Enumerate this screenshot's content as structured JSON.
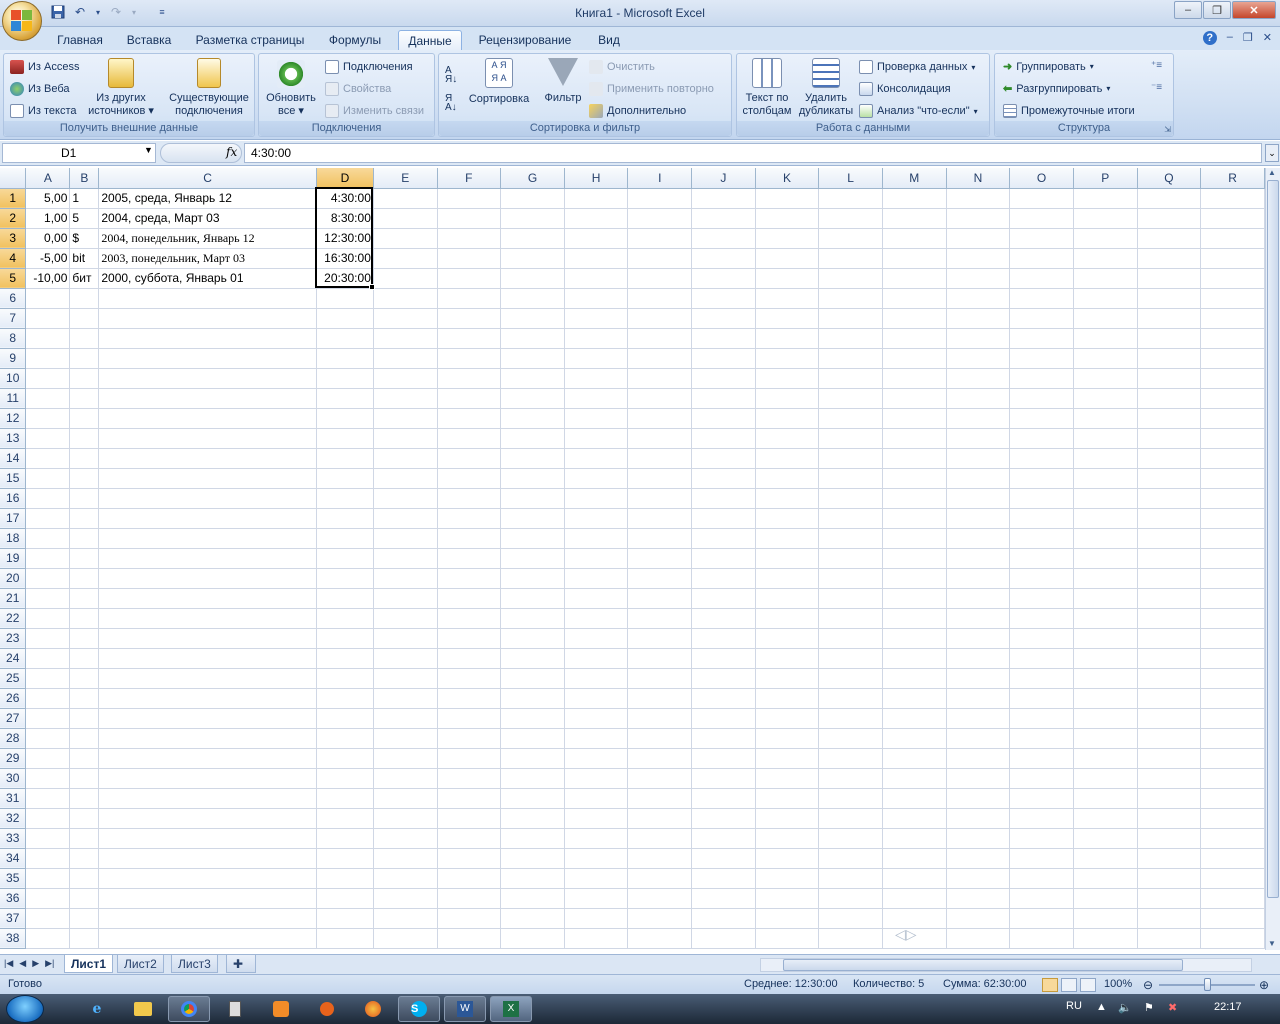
{
  "window": {
    "title": "Книга1 - Microsoft Excel",
    "controls": [
      "–",
      "❐",
      "✕"
    ]
  },
  "ribbon_tabs": [
    "Главная",
    "Вставка",
    "Разметка страницы",
    "Формулы",
    "Данные",
    "Рецензирование",
    "Вид"
  ],
  "active_tab": "Данные",
  "groups": {
    "external": {
      "label": "Получить внешние данные",
      "from_access": "Из Access",
      "from_web": "Из Веба",
      "from_text": "Из текста",
      "from_other": [
        "Из других",
        "источников"
      ],
      "existing": [
        "Существующие",
        "подключения"
      ]
    },
    "connections": {
      "label": "Подключения",
      "refresh": [
        "Обновить",
        "все"
      ],
      "connections": "Подключения",
      "properties": "Свойства",
      "edit_links": "Изменить связи"
    },
    "sort": {
      "label": "Сортировка и фильтр",
      "sort": "Сортировка",
      "filter": "Фильтр",
      "clear": "Очистить",
      "reapply": "Применить повторно",
      "advanced": "Дополнительно"
    },
    "tools": {
      "label": "Работа с данными",
      "text_to_cols": [
        "Текст по",
        "столбцам"
      ],
      "remove_dup": [
        "Удалить",
        "дубликаты"
      ],
      "validation": "Проверка данных",
      "consolidate": "Консолидация",
      "whatif": "Анализ \"что-если\""
    },
    "outline": {
      "label": "Структура",
      "group": "Группировать",
      "ungroup": "Разгруппировать",
      "subtotal": "Промежуточные итоги"
    }
  },
  "formula_bar": {
    "name_box": "D1",
    "fx": "fx",
    "value": "4:30:00"
  },
  "columns": [
    "A",
    "B",
    "C",
    "D",
    "E",
    "F",
    "G",
    "H",
    "I",
    "J",
    "K",
    "L",
    "M",
    "N",
    "O",
    "P",
    "Q",
    "R"
  ],
  "selected_column": "D",
  "rows": [
    [
      "5,00",
      "1",
      "2005, среда, Январь 12",
      "4:30:00"
    ],
    [
      "1,00",
      "5",
      "2004, среда, Март 03",
      "8:30:00"
    ],
    [
      "0,00",
      "$",
      "2004, понедельник, Январь 12",
      "12:30:00"
    ],
    [
      "-5,00",
      "bit",
      "2003, понедельник, Март 03",
      "16:30:00"
    ],
    [
      "-10,00",
      "бит",
      "2000, суббота, Январь 01",
      "20:30:00"
    ]
  ],
  "visible_row_count": 38,
  "sheets": [
    "Лист1",
    "Лист2",
    "Лист3"
  ],
  "active_sheet": "Лист1",
  "status": {
    "ready": "Готово",
    "average": "Среднее: 12:30:00",
    "count": "Количество: 5",
    "sum": "Сумма: 62:30:00",
    "zoom": "100%"
  },
  "taskbar": {
    "lang": "RU",
    "time": "22:17"
  }
}
